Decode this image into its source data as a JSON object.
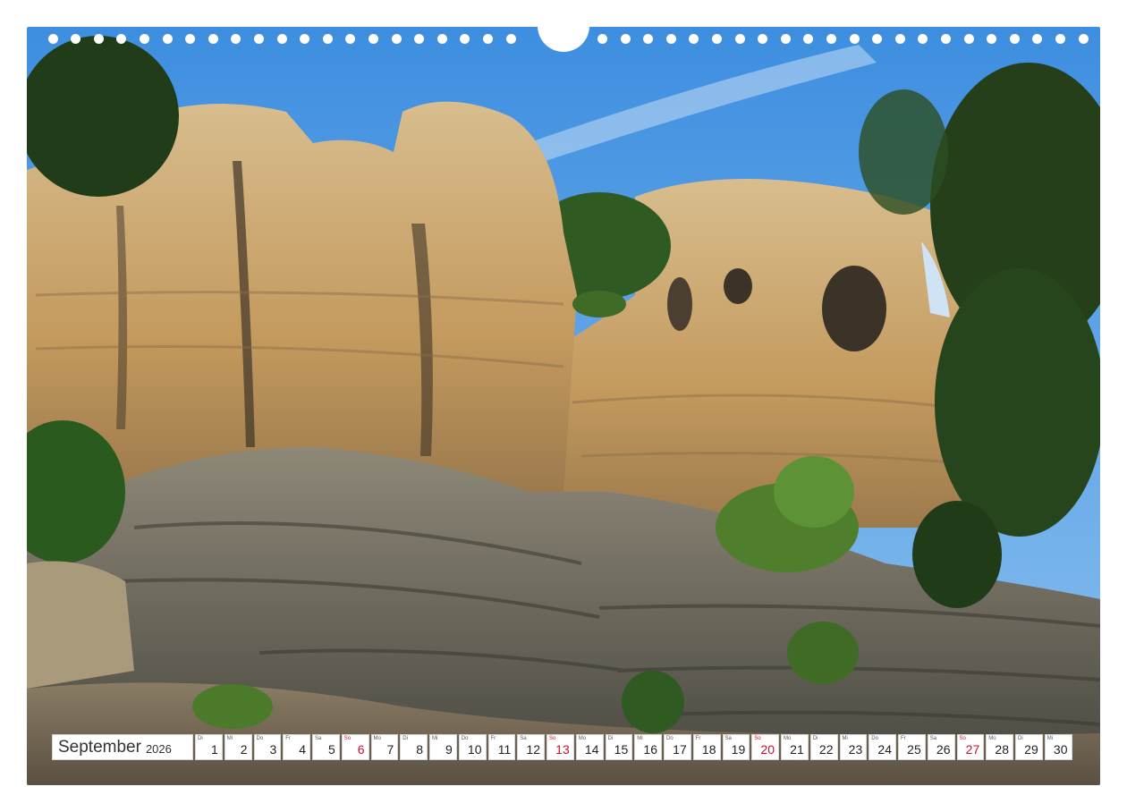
{
  "calendar": {
    "month": "September",
    "year": "2026",
    "days": [
      {
        "wd": "Di",
        "d": "1"
      },
      {
        "wd": "Mi",
        "d": "2"
      },
      {
        "wd": "Do",
        "d": "3"
      },
      {
        "wd": "Fr",
        "d": "4"
      },
      {
        "wd": "Sa",
        "d": "5"
      },
      {
        "wd": "So",
        "d": "6"
      },
      {
        "wd": "Mo",
        "d": "7"
      },
      {
        "wd": "Di",
        "d": "8"
      },
      {
        "wd": "Mi",
        "d": "9"
      },
      {
        "wd": "Do",
        "d": "10"
      },
      {
        "wd": "Fr",
        "d": "11"
      },
      {
        "wd": "Sa",
        "d": "12"
      },
      {
        "wd": "So",
        "d": "13"
      },
      {
        "wd": "Mo",
        "d": "14"
      },
      {
        "wd": "Di",
        "d": "15"
      },
      {
        "wd": "Mi",
        "d": "16"
      },
      {
        "wd": "Do",
        "d": "17"
      },
      {
        "wd": "Fr",
        "d": "18"
      },
      {
        "wd": "Sa",
        "d": "19"
      },
      {
        "wd": "So",
        "d": "20"
      },
      {
        "wd": "Mo",
        "d": "21"
      },
      {
        "wd": "Di",
        "d": "22"
      },
      {
        "wd": "Mi",
        "d": "23"
      },
      {
        "wd": "Do",
        "d": "24"
      },
      {
        "wd": "Fr",
        "d": "25"
      },
      {
        "wd": "Sa",
        "d": "26"
      },
      {
        "wd": "So",
        "d": "27"
      },
      {
        "wd": "Mo",
        "d": "28"
      },
      {
        "wd": "Di",
        "d": "29"
      },
      {
        "wd": "Mi",
        "d": "30"
      }
    ],
    "sunday_color": "#c8102e"
  },
  "colors": {
    "sky": "#4f9be0",
    "sandstone": "#c9a874",
    "rock_shadow": "#6f6a5e",
    "foliage": "#2f5a22"
  }
}
